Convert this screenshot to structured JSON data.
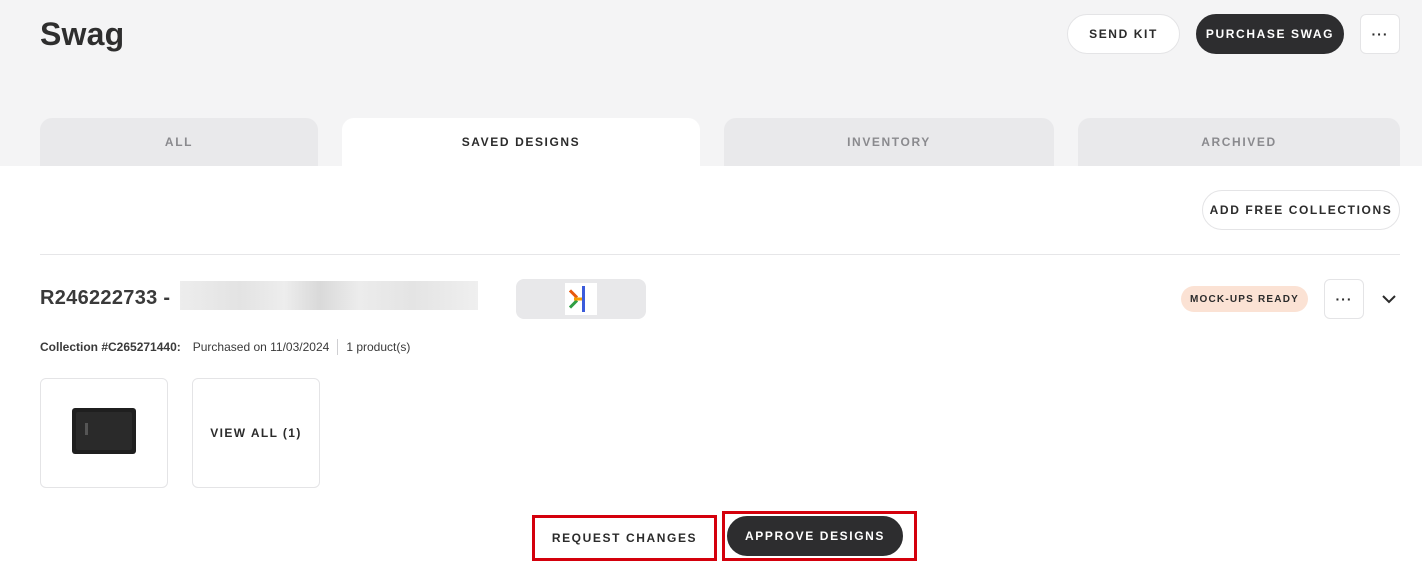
{
  "header": {
    "title": "Swag",
    "send_kit_label": "SEND KIT",
    "purchase_label": "PURCHASE SWAG",
    "more_label": "···"
  },
  "tabs": [
    {
      "label": "ALL",
      "active": false
    },
    {
      "label": "SAVED DESIGNS",
      "active": true
    },
    {
      "label": "INVENTORY",
      "active": false
    },
    {
      "label": "ARCHIVED",
      "active": false
    }
  ],
  "toolbar": {
    "add_collections_label": "ADD FREE COLLECTIONS"
  },
  "collection": {
    "id_prefix": "R246222733 -",
    "status_badge": "MOCK-UPS READY",
    "more_label": "···",
    "collection_number": "Collection #C265271440:",
    "purchased": "Purchased on 11/03/2024",
    "product_count": "1 product(s)",
    "view_all_label": "VIEW ALL (1)"
  },
  "actions": {
    "request_changes_label": "REQUEST CHANGES",
    "approve_label": "APPROVE DESIGNS"
  },
  "colors": {
    "accent_dark": "#2d2d2f",
    "badge_bg": "#fbe2d4",
    "highlight": "#d4000c"
  },
  "icons": {
    "company_logo": "asterisk-logo-icon",
    "expand": "chevron-down-icon",
    "product": "product-thumbnail"
  }
}
